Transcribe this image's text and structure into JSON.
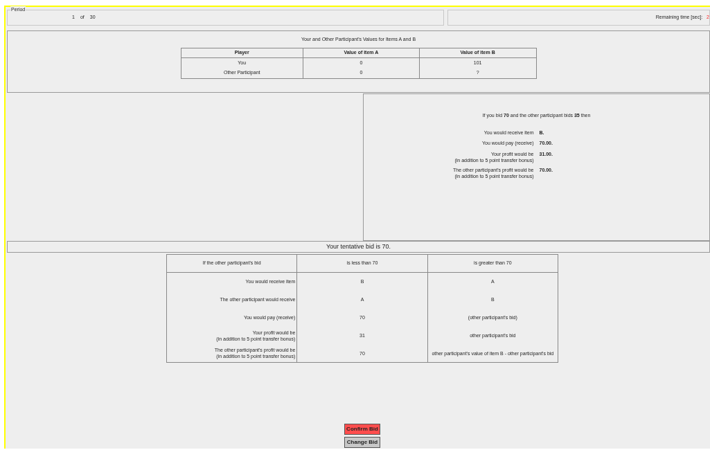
{
  "period": {
    "legend": "Period",
    "current": "1",
    "of": "of",
    "total": "30"
  },
  "remaining": {
    "label": "Remaining time [sec]:",
    "value": "2"
  },
  "values_table": {
    "title": "Your and Other Participant's Values for Items A and B",
    "columns": [
      "Player",
      "Value of item A",
      "Value of item B"
    ],
    "rows": [
      [
        "You",
        "0",
        "101"
      ],
      [
        "Other Participant",
        "0",
        "?"
      ]
    ]
  },
  "outcome": {
    "sentence": "If you bid **70** and the other participant bids **35** then",
    "lines": [
      {
        "label": "You would receive item",
        "value": "B."
      },
      {
        "label": "You would pay (receive)",
        "value": "70.00."
      },
      {
        "label": "Your profit would be\n(in addition to 5 point transfer bonus)",
        "value": "31.00."
      },
      {
        "label": "The other participant's profit would be\n(in addition to 5 point transfer bonus)",
        "value": "70.00."
      }
    ]
  },
  "tentative": "Your tentative bid is 70.",
  "bid_table": {
    "columns": [
      "If the other participant's bid",
      "is less than 70",
      "is greater than 70"
    ],
    "rows": [
      [
        "You would receive item",
        "B",
        "A"
      ],
      [
        "The other participant would receive",
        "A",
        "B"
      ],
      [
        "You would pay (receive)",
        "70",
        "(other participant's bid)"
      ],
      [
        "Your profit would be\n(in addition to 5 point transfer bonus)",
        "31",
        "other participant's bid"
      ],
      [
        "The other participant's profit would be\n(in addition to 5 point transfer bonus)",
        "70",
        "other participant's value of item B - other participant's bid"
      ]
    ]
  },
  "buttons": [
    {
      "label": "Confirm Bid",
      "kind": "primary"
    },
    {
      "label": "Change Bid",
      "kind": "secondary"
    }
  ]
}
